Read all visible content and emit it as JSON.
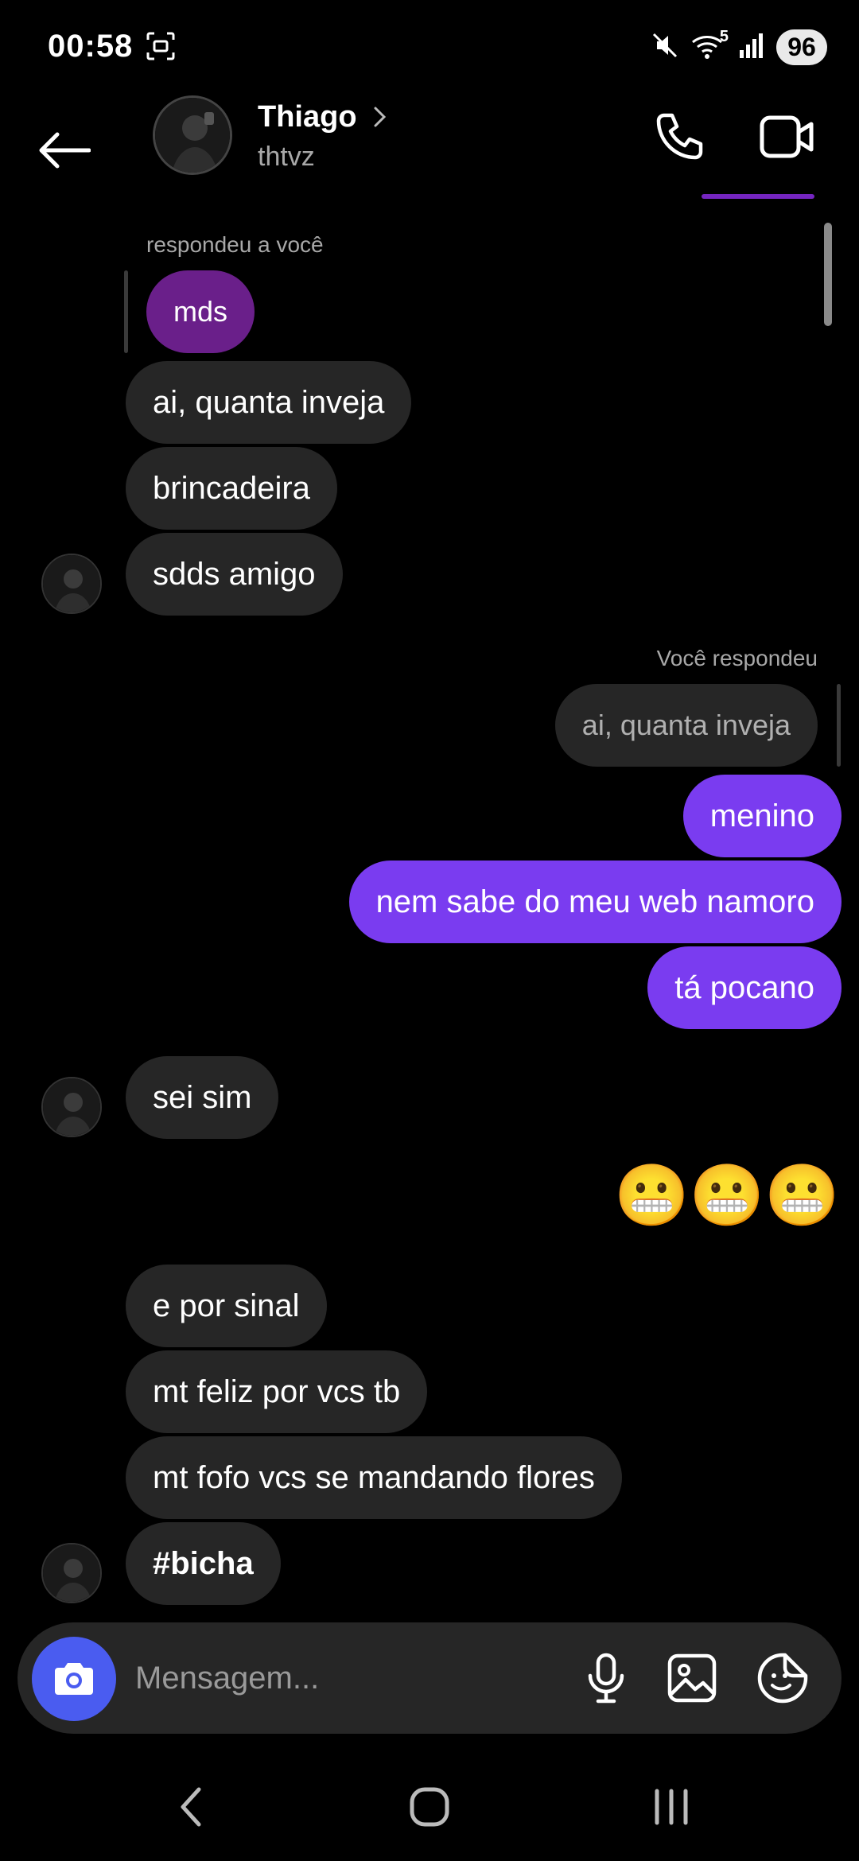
{
  "status_bar": {
    "time": "00:58",
    "battery": "96",
    "network_badge": "5",
    "icons": [
      "screenshot-icon",
      "mute-icon",
      "wifi-icon",
      "signal-icon"
    ]
  },
  "header": {
    "name": "Thiago",
    "username": "thtvz",
    "icons": [
      "back-arrow-icon",
      "chevron-right-icon",
      "phone-icon",
      "video-camera-icon"
    ]
  },
  "messages": {
    "reply_label_in": "respondeu a você",
    "reply_quote_in": "mds",
    "m1": "ai, quanta inveja",
    "m2": "brincadeira",
    "m3": "sdds amigo",
    "reply_label_out": "Você respondeu",
    "reply_quote_out": "ai, quanta inveja",
    "m4": "menino",
    "m5": "nem sabe do meu web namoro",
    "m6": "tá pocano",
    "m7": "sei sim",
    "m8": "😬😬😬",
    "m9": "e por sinal",
    "m10": "mt feliz por vcs tb",
    "m11": "mt fofo vcs se mandando flores",
    "m12": "#bicha"
  },
  "composer": {
    "placeholder": "Mensagem...",
    "icons": [
      "camera-icon",
      "microphone-icon",
      "gallery-icon",
      "sticker-icon"
    ]
  },
  "nav": {
    "icons": [
      "nav-back-icon",
      "nav-home-icon",
      "nav-recents-icon"
    ]
  },
  "colors": {
    "background": "#000000",
    "incoming_bubble": "#262626",
    "outgoing_bubble": "#7a3cf0",
    "reply_purple": "#6a1f8a",
    "camera_button": "#4a5cf0"
  }
}
